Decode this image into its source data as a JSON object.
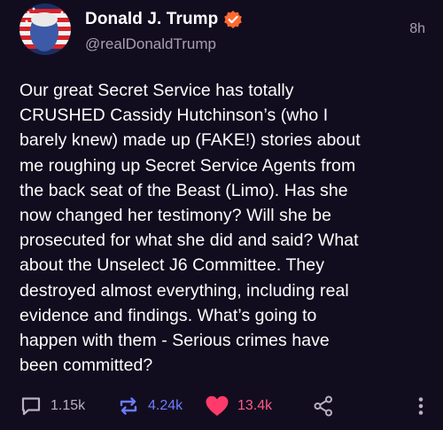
{
  "post": {
    "display_name": "Donald J. Trump",
    "handle": "@realDonaldTrump",
    "time": "8h",
    "text": "Our great Secret Service has totally\nCRUSHED Cassidy Hutchinson’s (who I\nbarely knew) made up (FAKE!) stories about\nme roughing up Secret Service Agents from\nthe back seat of the Beast (Limo). Has she\nnow changed her testimony? Will she be\nprosecuted for what she did and said? What\nabout the Unselect J6 Committee. They\ndestroyed almost everything, including real\nevidence and findings. What’s going to\nhappen with them - Serious crimes have\nbeen committed?"
  },
  "actions": {
    "replies": "1.15k",
    "reposts": "4.24k",
    "likes": "13.4k"
  },
  "icons": {
    "reply": "reply-icon",
    "repost": "repost-icon",
    "like": "heart-icon",
    "share": "share-icon",
    "more": "more-vertical-icon",
    "verified": "verified-badge-icon"
  },
  "colors": {
    "background": "#120d1e",
    "verified": "#ff6a2f",
    "repost": "#6c7cff",
    "like": "#ff3b6b",
    "muted": "#a79fb3"
  }
}
